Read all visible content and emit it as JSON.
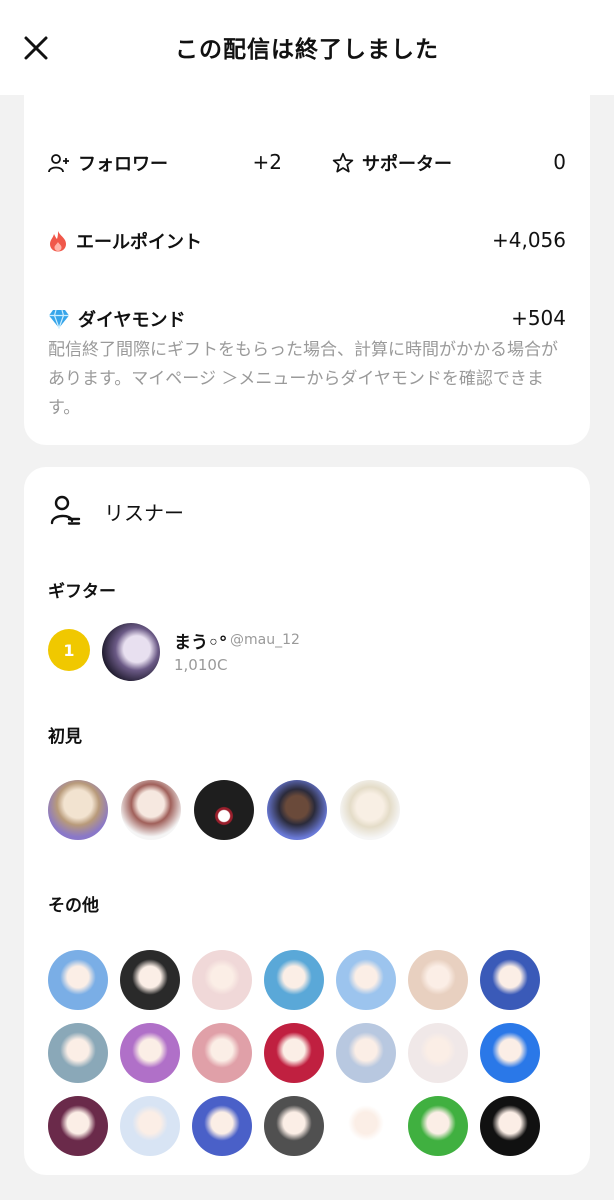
{
  "header": {
    "title": "この配信は終了しました"
  },
  "stats": {
    "followers": {
      "label": "フォロワー",
      "value": "+2"
    },
    "supporters": {
      "label": "サポーター",
      "value": "0"
    },
    "yell_points": {
      "label": "エールポイント",
      "value": "+4,056"
    },
    "diamonds": {
      "label": "ダイヤモンド",
      "value": "+504"
    },
    "note": "配信終了間際にギフトをもらった場合、計算に時間がかかる場合があります。マイページ ＞メニューからダイヤモンドを確認できます。"
  },
  "listeners": {
    "title": "リスナー",
    "gifters_title": "ギフター",
    "gifter": {
      "rank": "1",
      "name": "まう◦°",
      "handle": "@mau_12",
      "coins": "1,010C"
    },
    "first_time_title": "初見",
    "first_time_avatar_count": 5,
    "others_title": "その他",
    "others_avatar_count": 21
  },
  "colors": {
    "badge_gold": "#f0c800",
    "fire_red": "#f0584a",
    "diamond_blue": "#37a5ea",
    "note_gray": "#9a9a9a"
  },
  "icons": [
    "close-icon",
    "add-user-icon",
    "star-icon",
    "fire-icon",
    "diamond-icon",
    "listener-icon"
  ]
}
